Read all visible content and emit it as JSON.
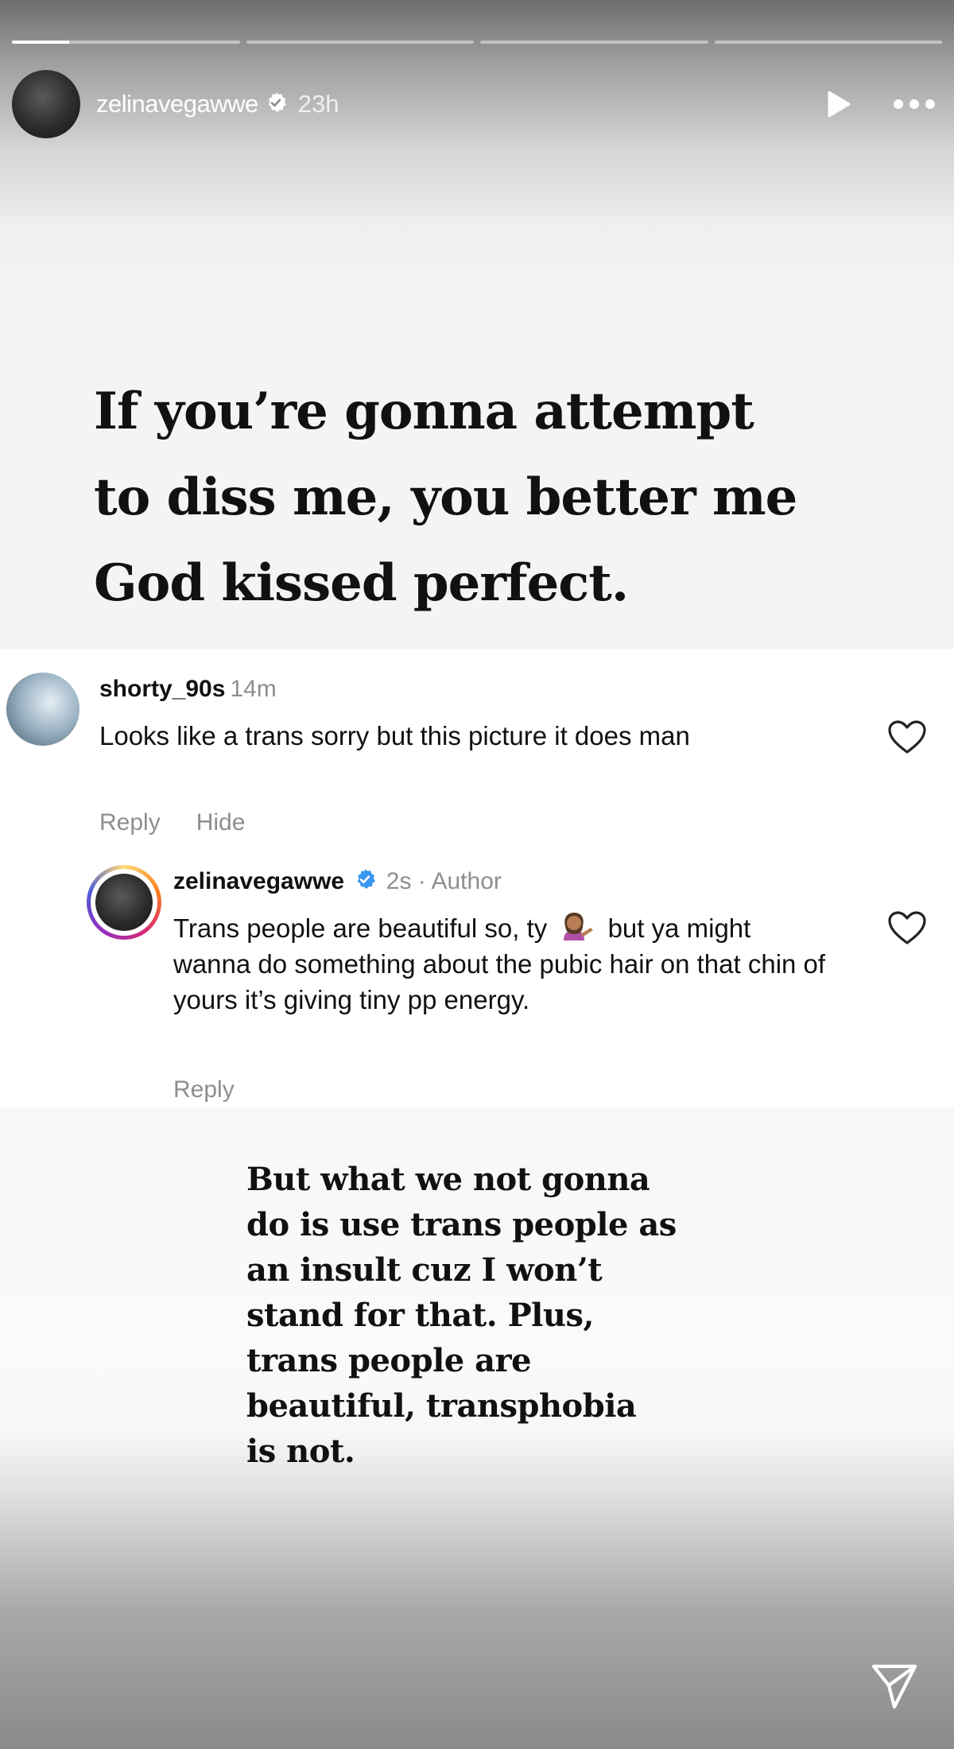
{
  "story": {
    "progress_segments": [
      0.25,
      0,
      0,
      0
    ],
    "header": {
      "username": "zelinavegawwe",
      "time": "23h"
    },
    "headline_lines": [
      "If you’re gonna attempt",
      "to diss me, you better me",
      "God kissed perfect."
    ],
    "comments": [
      {
        "username": "shorty_90s",
        "time": "14m",
        "text": "Looks like a trans sorry but this picture it does man",
        "reply_label": "Reply",
        "hide_label": "Hide"
      },
      {
        "username": "zelinavegawwe",
        "meta": "2s · Author",
        "text_before_emoji": "Trans people are beautiful so, ty",
        "emoji": "person-tipping-hand",
        "text_after_emoji": "but ya might wanna do something about the pubic hair on that chin of yours it’s giving tiny pp energy.",
        "reply_label": "Reply"
      }
    ],
    "statement_lines": [
      "But what we not gonna",
      "do is use trans people as",
      "an insult cuz I won’t",
      "stand for that. Plus,",
      "trans people are",
      "beautiful, transphobia",
      "is not."
    ],
    "icons": {
      "verified": "verified-badge-icon",
      "play": "play-icon",
      "more": "more-options-icon",
      "heart": "heart-icon",
      "share": "send-icon"
    },
    "colors": {
      "verified": "#3897f0",
      "muted_text": "#8e8e8e",
      "text": "#111111"
    }
  }
}
